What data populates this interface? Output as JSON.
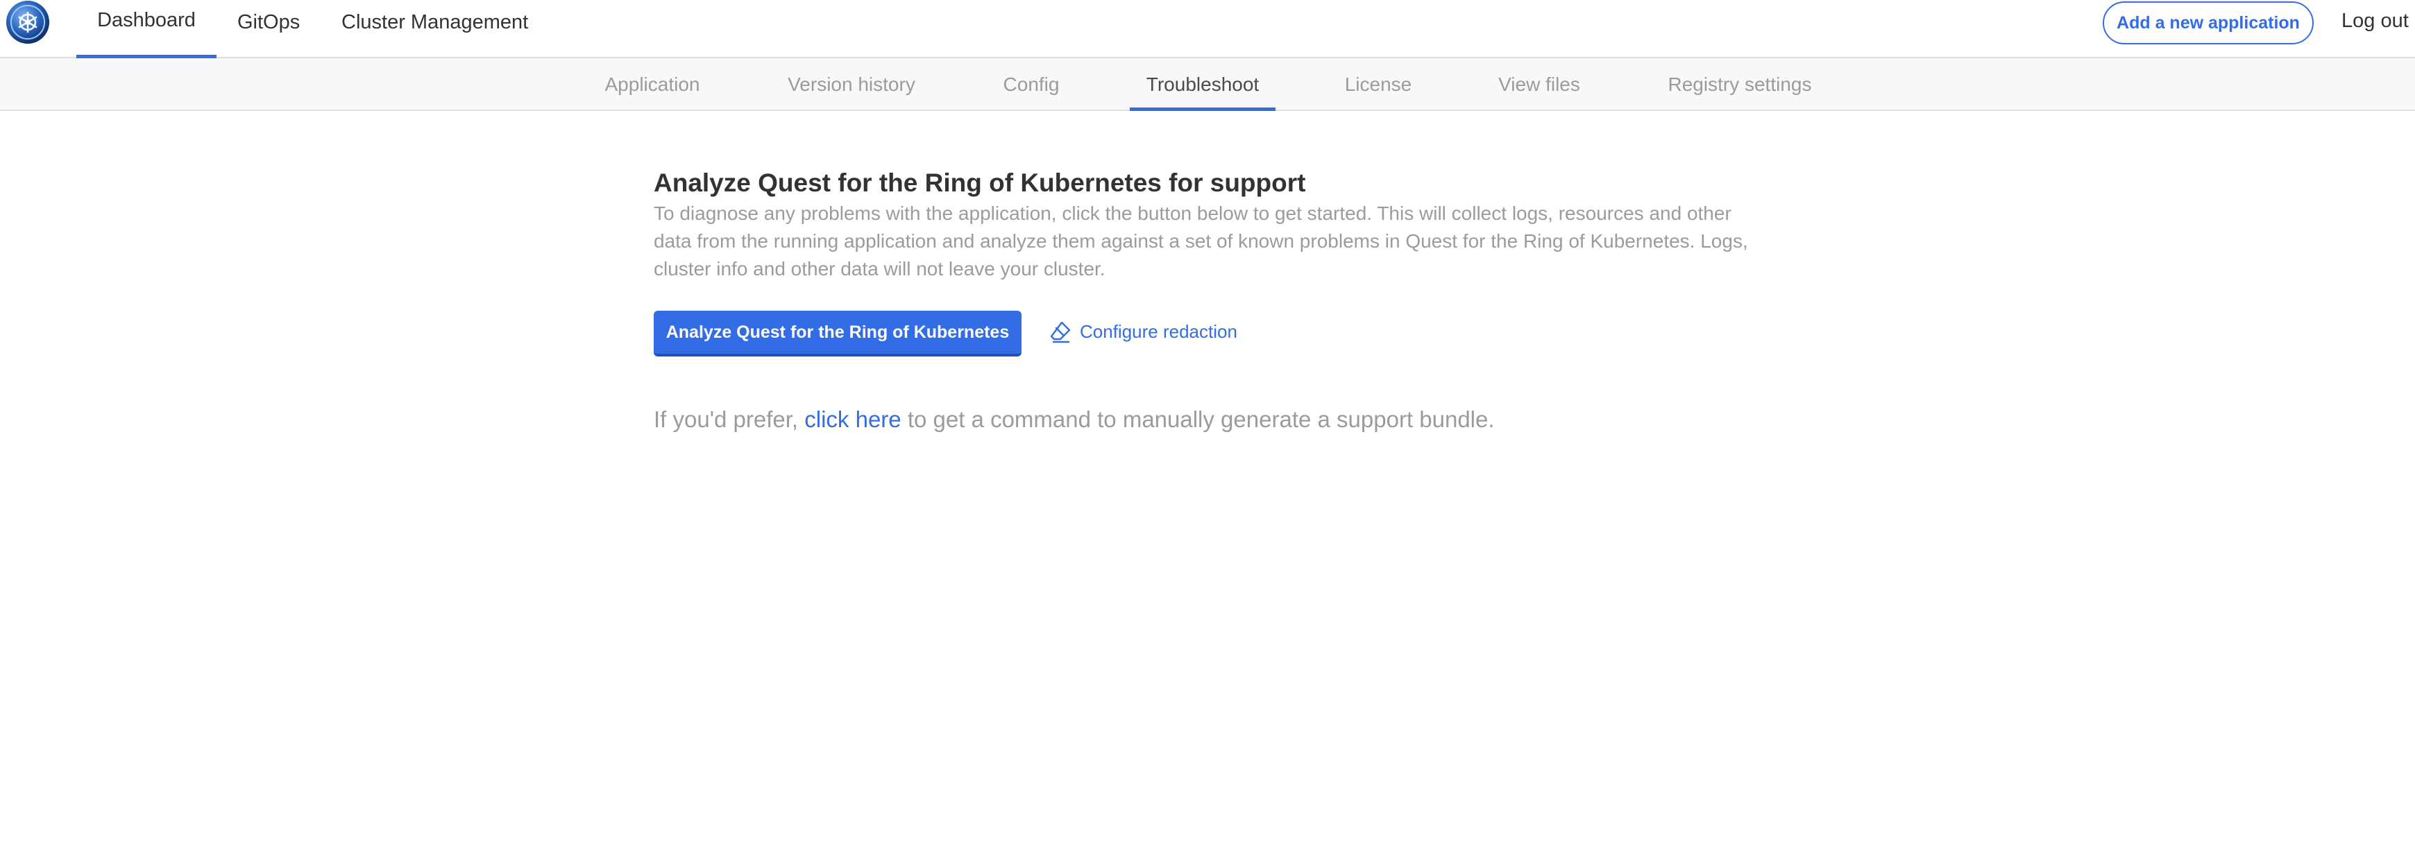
{
  "topnav": {
    "items": [
      {
        "label": "Dashboard",
        "active": true
      },
      {
        "label": "GitOps",
        "active": false
      },
      {
        "label": "Cluster Management",
        "active": false
      }
    ],
    "add_app_label": "Add a new application",
    "logout_label": "Log out",
    "logo_icon": "kubernetes-wheel-icon"
  },
  "subnav": {
    "tabs": [
      {
        "label": "Application",
        "active": false
      },
      {
        "label": "Version history",
        "active": false
      },
      {
        "label": "Config",
        "active": false
      },
      {
        "label": "Troubleshoot",
        "active": true
      },
      {
        "label": "License",
        "active": false
      },
      {
        "label": "View files",
        "active": false
      },
      {
        "label": "Registry settings",
        "active": false
      }
    ]
  },
  "main": {
    "title": "Analyze Quest for the Ring of Kubernetes for support",
    "description": "To diagnose any problems with the application, click the button below to get started. This will collect logs, resources and other data from the running application and analyze them against a set of known problems in Quest for the Ring of Kubernetes. Logs, cluster info and other data will not leave your cluster.",
    "analyze_button": "Analyze Quest for the Ring of Kubernetes",
    "configure_redaction": "Configure redaction",
    "manual_prefix": "If you'd prefer, ",
    "manual_link": "click here",
    "manual_suffix": " to get a command to manually generate a support bundle."
  },
  "colors": {
    "accent": "#326de6",
    "text_dark": "#323232",
    "text_muted": "#9b9b9b",
    "subnav_bg": "#f8f8f8"
  }
}
